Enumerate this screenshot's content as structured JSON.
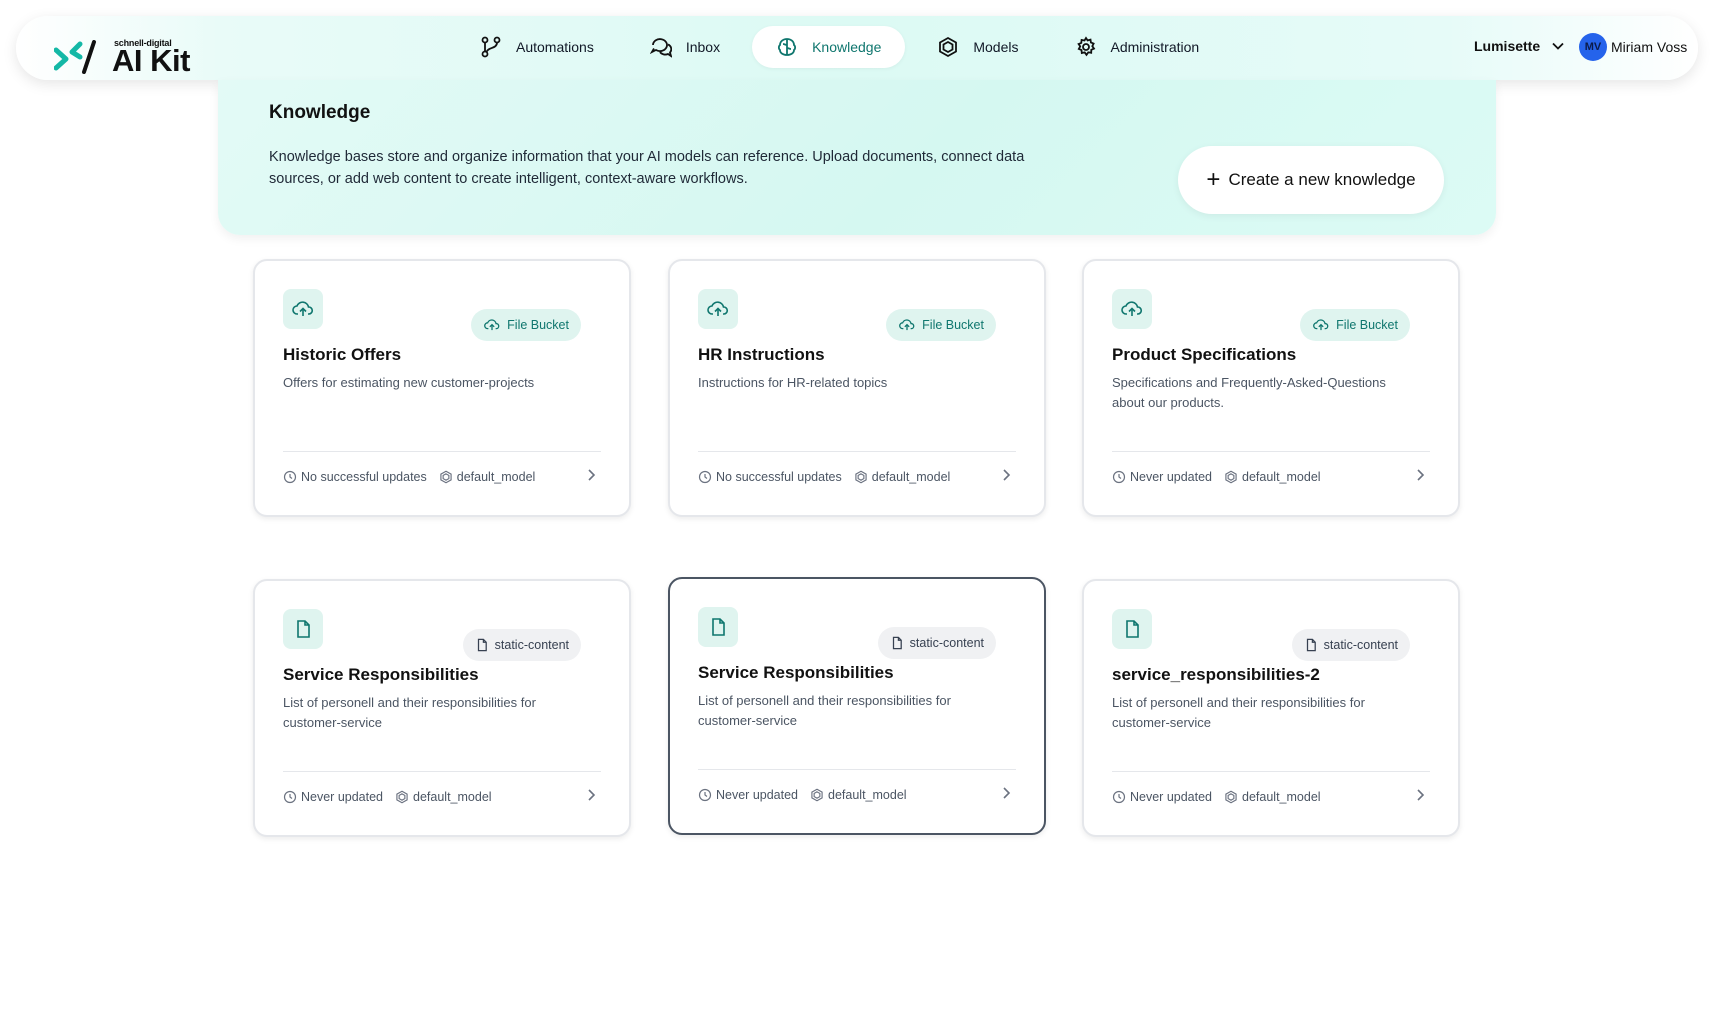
{
  "brand": {
    "small": "schnell-digital",
    "name": "AI Kit",
    "accent": "#14b8a6"
  },
  "nav": [
    {
      "label": "Automations",
      "icon": "automations-icon",
      "active": false
    },
    {
      "label": "Inbox",
      "icon": "inbox-icon",
      "active": false
    },
    {
      "label": "Knowledge",
      "icon": "knowledge-icon",
      "active": true
    },
    {
      "label": "Models",
      "icon": "models-icon",
      "active": false
    },
    {
      "label": "Administration",
      "icon": "gear-icon",
      "active": false
    }
  ],
  "org": {
    "name": "Lumisette"
  },
  "user": {
    "initials": "MV",
    "name": "Miriam Voss"
  },
  "hero": {
    "title": "Knowledge",
    "description": "Knowledge bases store and organize information that your AI models can reference. Upload documents, connect data sources, or add web content to create intelligent, context-aware workflows.",
    "create_label": "Create a new knowledge"
  },
  "cards": [
    {
      "title": "Historic Offers",
      "description": "Offers for estimating new customer-projects",
      "badge": "File Bucket",
      "status": "No successful updates",
      "model": "default_model"
    },
    {
      "title": "HR Instructions",
      "description": "Instructions for HR-related topics",
      "badge": "File Bucket",
      "status": "No successful updates",
      "model": "default_model"
    },
    {
      "title": "Product Specifications",
      "description": "Specifications and Frequently-Asked-Questions about our products.",
      "badge": "File Bucket",
      "status": "Never updated",
      "model": "default_model"
    },
    {
      "title": "Service Responsibilities",
      "description": "List of personell and their responsibilities for customer-service",
      "badge": "static-content",
      "status": "Never updated",
      "model": "default_model"
    },
    {
      "title": "Service Responsibilities",
      "description": "List of personell and their responsibilities for customer-service",
      "badge": "static-content",
      "status": "Never updated",
      "model": "default_model"
    },
    {
      "title": "service_responsibilities-2",
      "description": "List of personell and their responsibilities for customer-service",
      "badge": "static-content",
      "status": "Never updated",
      "model": "default_model"
    }
  ]
}
